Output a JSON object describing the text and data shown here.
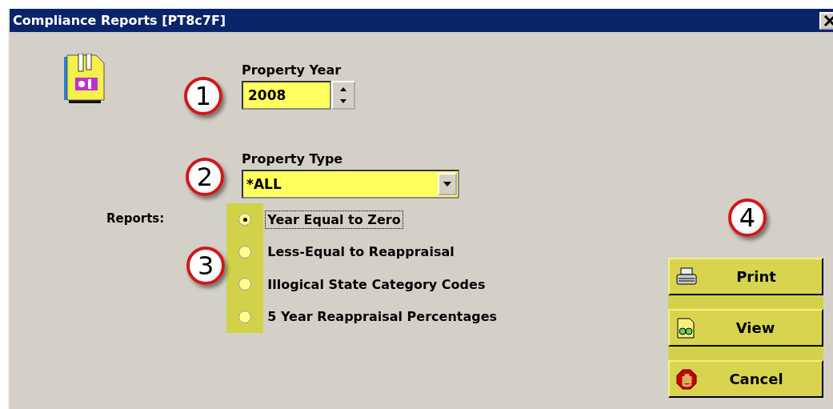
{
  "window": {
    "title": "Compliance Reports [PT8c7F]"
  },
  "property_year": {
    "label": "Property Year",
    "value": "2008",
    "callout": "1"
  },
  "property_type": {
    "label": "Property Type",
    "value": "*ALL",
    "callout": "2"
  },
  "reports": {
    "label": "Reports:",
    "callout": "3",
    "options": [
      {
        "label": "Year Equal to Zero",
        "selected": true,
        "focused": true
      },
      {
        "label": "Less-Equal to Reappraisal",
        "selected": false,
        "focused": false
      },
      {
        "label": "Illogical State Category Codes",
        "selected": false,
        "focused": false
      },
      {
        "label": "5 Year Reappraisal Percentages",
        "selected": false,
        "focused": false
      }
    ]
  },
  "buttons": {
    "callout": "4",
    "items": [
      {
        "label": "Print",
        "kind": "print"
      },
      {
        "label": "View",
        "kind": "view"
      },
      {
        "label": "Cancel",
        "kind": "cancel"
      }
    ]
  }
}
